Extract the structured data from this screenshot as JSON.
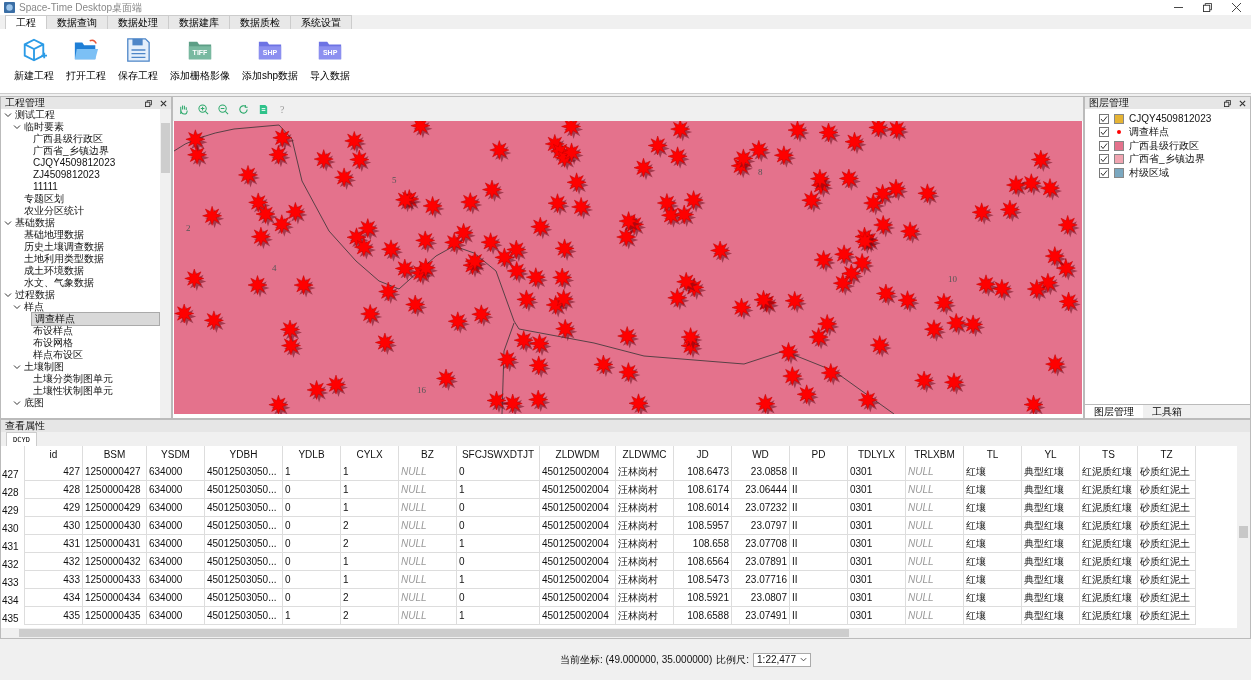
{
  "window": {
    "title": "Space-Time Desktop桌面端"
  },
  "menu_tabs": [
    {
      "label": "工程",
      "selected": true
    },
    {
      "label": "数据查询",
      "selected": false
    },
    {
      "label": "数据处理",
      "selected": false
    },
    {
      "label": "数据建库",
      "selected": false
    },
    {
      "label": "数据质检",
      "selected": false
    },
    {
      "label": "系统设置",
      "selected": false
    }
  ],
  "ribbon": [
    {
      "kind": "new",
      "label": "新建工程"
    },
    {
      "kind": "open",
      "label": "打开工程"
    },
    {
      "kind": "save",
      "label": "保存工程"
    },
    {
      "kind": "raster",
      "label": "添加栅格影像",
      "badge": "TIFF"
    },
    {
      "kind": "shp",
      "label": "添加shp数据",
      "badge": "SHP"
    },
    {
      "kind": "shp",
      "label": "导入数据",
      "badge": "SHP"
    }
  ],
  "project_panel": {
    "title": "工程管理",
    "tree": [
      {
        "label": "测试工程",
        "expanded": true,
        "selected": false,
        "children": [
          {
            "label": "临时要素",
            "expanded": true,
            "selected": false,
            "children": [
              {
                "label": "广西县级行政区",
                "selected": false
              },
              {
                "label": "广西省_乡镇边界",
                "selected": false
              },
              {
                "label": "CJQY4509812023",
                "selected": false
              },
              {
                "label": "ZJ4509812023",
                "selected": false
              },
              {
                "label": "11111",
                "selected": false
              }
            ]
          },
          {
            "label": "专题区划",
            "selected": false
          },
          {
            "label": "农业分区统计",
            "selected": false
          }
        ]
      },
      {
        "label": "基础数据",
        "expanded": true,
        "selected": false,
        "children": [
          {
            "label": "基础地理数据",
            "selected": false
          },
          {
            "label": "历史土壤调查数据",
            "selected": false
          },
          {
            "label": "土地利用类型数据",
            "selected": false
          },
          {
            "label": "成土环境数据",
            "selected": false
          },
          {
            "label": "水文、气象数据",
            "selected": false
          }
        ]
      },
      {
        "label": "过程数据",
        "expanded": true,
        "selected": false,
        "children": [
          {
            "label": "样点",
            "expanded": true,
            "selected": false,
            "children": [
              {
                "label": "调查样点",
                "selected": true
              },
              {
                "label": "布设样点",
                "selected": false
              },
              {
                "label": "布设网格",
                "selected": false
              },
              {
                "label": "样点布设区",
                "selected": false
              }
            ]
          },
          {
            "label": "土壤制图",
            "expanded": true,
            "selected": false,
            "children": [
              {
                "label": "土壤分类制图单元",
                "selected": false
              },
              {
                "label": "土壤性状制图单元",
                "selected": false
              }
            ]
          },
          {
            "label": "底图",
            "expanded": true,
            "selected": false
          }
        ]
      }
    ]
  },
  "map": {
    "tools": [
      {
        "kind": "pan"
      },
      {
        "kind": "zoom_in"
      },
      {
        "kind": "zoom_out"
      },
      {
        "kind": "refresh"
      },
      {
        "kind": "export"
      },
      {
        "kind": "help",
        "label": "?"
      }
    ],
    "labels": [
      "2",
      "4",
      "5",
      "8",
      "10",
      "16"
    ]
  },
  "layer_panel": {
    "title": "图层管理",
    "layers": [
      {
        "label": "CJQY4509812023",
        "checked": true,
        "kind": "fill",
        "color": "#e6b434"
      },
      {
        "label": "调查样点",
        "checked": true,
        "kind": "point",
        "color": "#ff0000"
      },
      {
        "label": "广西县级行政区",
        "checked": true,
        "kind": "fill",
        "color": "#e4728c"
      },
      {
        "label": "广西省_乡镇边界",
        "checked": true,
        "kind": "fill",
        "color": "#f0a4b0"
      },
      {
        "label": "村级区域",
        "checked": true,
        "kind": "fill",
        "color": "#7ba8c0"
      }
    ],
    "tabs": [
      {
        "label": "图层管理",
        "selected": true
      },
      {
        "label": "工具箱",
        "selected": false
      }
    ]
  },
  "attribute_panel": {
    "title": "查看属性",
    "tabs": [
      {
        "label": "DCYD",
        "selected": true
      }
    ],
    "columns": [
      {
        "name": "id",
        "kind": "number"
      },
      {
        "name": "BSM",
        "kind": "text"
      },
      {
        "name": "YSDM",
        "kind": "text"
      },
      {
        "name": "YDBH",
        "kind": "text"
      },
      {
        "name": "YDLB",
        "kind": "text"
      },
      {
        "name": "CYLX",
        "kind": "text"
      },
      {
        "name": "BZ",
        "kind": "null"
      },
      {
        "name": "SFCJSWXDTJT",
        "kind": "text"
      },
      {
        "name": "ZLDWDM",
        "kind": "text"
      },
      {
        "name": "ZLDWMC",
        "kind": "text"
      },
      {
        "name": "JD",
        "kind": "number"
      },
      {
        "name": "WD",
        "kind": "number"
      },
      {
        "name": "PD",
        "kind": "text"
      },
      {
        "name": "TDLYLX",
        "kind": "text"
      },
      {
        "name": "TRLXBM",
        "kind": "null"
      },
      {
        "name": "TL",
        "kind": "text"
      },
      {
        "name": "YL",
        "kind": "text"
      },
      {
        "name": "TS",
        "kind": "text"
      },
      {
        "name": "TZ",
        "kind": "text"
      }
    ],
    "rows": [
      {
        "num": "427",
        "cells": [
          "427",
          "1250000427",
          "634000",
          "45012503050...",
          "1",
          "1",
          "NULL",
          "0",
          "450125002004",
          "汪林岗村",
          "108.6473",
          "23.0858",
          "II",
          "0301",
          "NULL",
          "红壤",
          "典型红壤",
          "红泥质红壤",
          "砂质红泥土"
        ]
      },
      {
        "num": "428",
        "cells": [
          "428",
          "1250000428",
          "634000",
          "45012503050...",
          "0",
          "1",
          "NULL",
          "1",
          "450125002004",
          "汪林岗村",
          "108.6174",
          "23.06444",
          "II",
          "0301",
          "NULL",
          "红壤",
          "典型红壤",
          "红泥质红壤",
          "砂质红泥土"
        ]
      },
      {
        "num": "429",
        "cells": [
          "429",
          "1250000429",
          "634000",
          "45012503050...",
          "0",
          "1",
          "NULL",
          "0",
          "450125002004",
          "汪林岗村",
          "108.6014",
          "23.07232",
          "II",
          "0301",
          "NULL",
          "红壤",
          "典型红壤",
          "红泥质红壤",
          "砂质红泥土"
        ]
      },
      {
        "num": "430",
        "cells": [
          "430",
          "1250000430",
          "634000",
          "45012503050...",
          "0",
          "2",
          "NULL",
          "0",
          "450125002004",
          "汪林岗村",
          "108.5957",
          "23.0797",
          "II",
          "0301",
          "NULL",
          "红壤",
          "典型红壤",
          "红泥质红壤",
          "砂质红泥土"
        ]
      },
      {
        "num": "431",
        "cells": [
          "431",
          "1250000431",
          "634000",
          "45012503050...",
          "0",
          "2",
          "NULL",
          "1",
          "450125002004",
          "汪林岗村",
          "108.658",
          "23.07708",
          "II",
          "0301",
          "NULL",
          "红壤",
          "典型红壤",
          "红泥质红壤",
          "砂质红泥土"
        ]
      },
      {
        "num": "432",
        "cells": [
          "432",
          "1250000432",
          "634000",
          "45012503050...",
          "0",
          "1",
          "NULL",
          "0",
          "450125002004",
          "汪林岗村",
          "108.6564",
          "23.07891",
          "II",
          "0301",
          "NULL",
          "红壤",
          "典型红壤",
          "红泥质红壤",
          "砂质红泥土"
        ]
      },
      {
        "num": "433",
        "cells": [
          "433",
          "1250000433",
          "634000",
          "45012503050...",
          "0",
          "1",
          "NULL",
          "1",
          "450125002004",
          "汪林岗村",
          "108.5473",
          "23.07716",
          "II",
          "0301",
          "NULL",
          "红壤",
          "典型红壤",
          "红泥质红壤",
          "砂质红泥土"
        ]
      },
      {
        "num": "434",
        "cells": [
          "434",
          "1250000434",
          "634000",
          "45012503050...",
          "0",
          "2",
          "NULL",
          "0",
          "450125002004",
          "汪林岗村",
          "108.5921",
          "23.0807",
          "II",
          "0301",
          "NULL",
          "红壤",
          "典型红壤",
          "红泥质红壤",
          "砂质红泥土"
        ]
      },
      {
        "num": "435",
        "cells": [
          "435",
          "1250000435",
          "634000",
          "45012503050...",
          "1",
          "2",
          "NULL",
          "1",
          "450125002004",
          "汪林岗村",
          "108.6588",
          "23.07491",
          "II",
          "0301",
          "NULL",
          "红壤",
          "典型红壤",
          "红泥质红壤",
          "砂质红泥土"
        ]
      }
    ]
  },
  "status_bar": {
    "coordinates": "当前坐标: (49.000000, 35.000000)",
    "scale_label": "比例尺:",
    "scale_value": "1:22,477"
  }
}
